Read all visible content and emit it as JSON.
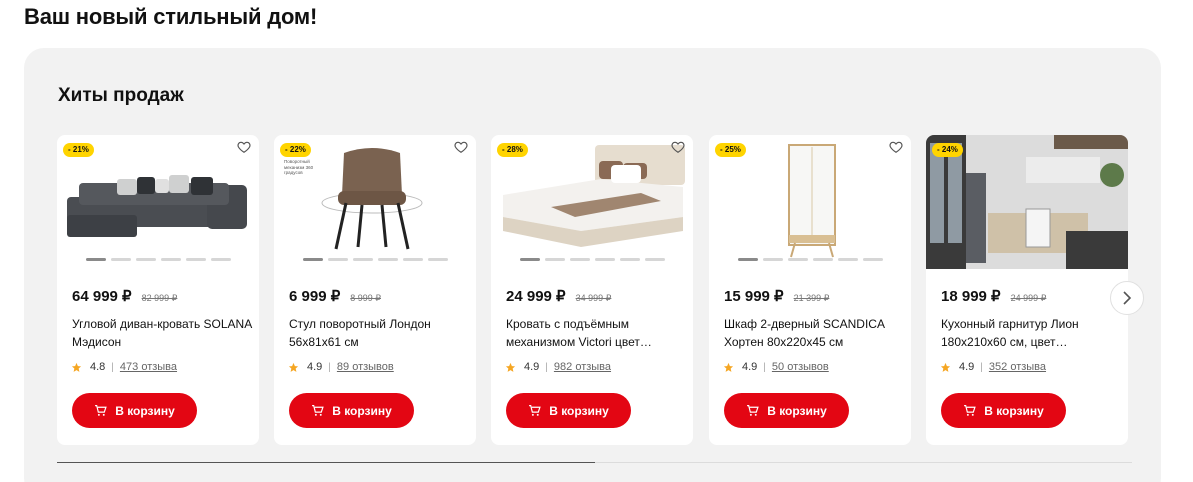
{
  "page": {
    "title": "Ваш новый стильный дом!"
  },
  "section": {
    "title": "Хиты продаж"
  },
  "colors": {
    "accent": "#e30613",
    "badge": "#ffd400",
    "star": "#f5a623"
  },
  "slider": {
    "progress_percent": 50
  },
  "products": [
    {
      "discount": "- 21%",
      "price": "64 999 ₽",
      "old_price": "82 999 ₽",
      "name": "Угловой диван-кровать SOLANA Мэдисон",
      "rating": "4.8",
      "reviews": "473 отзыва",
      "cart_label": "В корзину"
    },
    {
      "discount": "- 22%",
      "price": "6 999 ₽",
      "old_price": "8 999 ₽",
      "name": "Стул поворотный Лондон 56х81х61 см",
      "rating": "4.9",
      "reviews": "89 отзывов",
      "cart_label": "В корзину",
      "image_caption": "Поворотный механизм 360 градусов"
    },
    {
      "discount": "- 28%",
      "price": "24 999 ₽",
      "old_price": "34 999 ₽",
      "name": "Кровать с подъёмным механизмом Victori цвет…",
      "rating": "4.9",
      "reviews": "982 отзыва",
      "cart_label": "В корзину"
    },
    {
      "discount": "- 25%",
      "price": "15 999 ₽",
      "old_price": "21 399 ₽",
      "name": "Шкаф 2-дверный SCANDICA Хортен 80х220х45 см",
      "rating": "4.9",
      "reviews": "50 отзывов",
      "cart_label": "В корзину"
    },
    {
      "discount": "- 24%",
      "price": "18 999 ₽",
      "old_price": "24 999 ₽",
      "name": "Кухонный гарнитур Лион 180х210х60 см, цвет…",
      "rating": "4.9",
      "reviews": "352 отзыва",
      "cart_label": "В корзину"
    }
  ]
}
